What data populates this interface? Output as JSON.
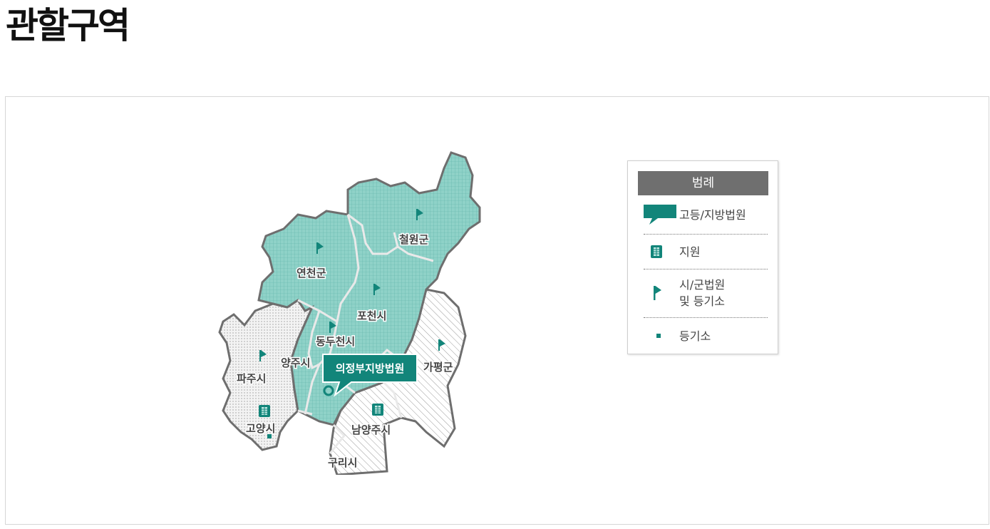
{
  "page": {
    "title": "관할구역"
  },
  "map": {
    "court_callout": "의정부지방법원",
    "regions": {
      "cheorwon": "철원군",
      "yeoncheon": "연천군",
      "pocheon": "포천시",
      "dongducheon": "동두천시",
      "yangju": "양주시",
      "paju": "파주시",
      "goyang": "고양시",
      "gapyeong": "가평군",
      "namyangju": "남양주시",
      "guri": "구리시"
    },
    "colors": {
      "court": "#12857a",
      "primary_region": "#8fd2c8",
      "border": "#6e6e6e",
      "label": "#444444"
    }
  },
  "legend": {
    "title": "범례",
    "items": [
      {
        "icon": "speech-flag-icon",
        "label": "고등/지방법원"
      },
      {
        "icon": "building-icon",
        "label": "지원"
      },
      {
        "icon": "flag-icon",
        "label_line1": "시/군법원",
        "label_line2": "및 등기소"
      },
      {
        "icon": "square-dot-icon",
        "label": "등기소"
      }
    ]
  }
}
